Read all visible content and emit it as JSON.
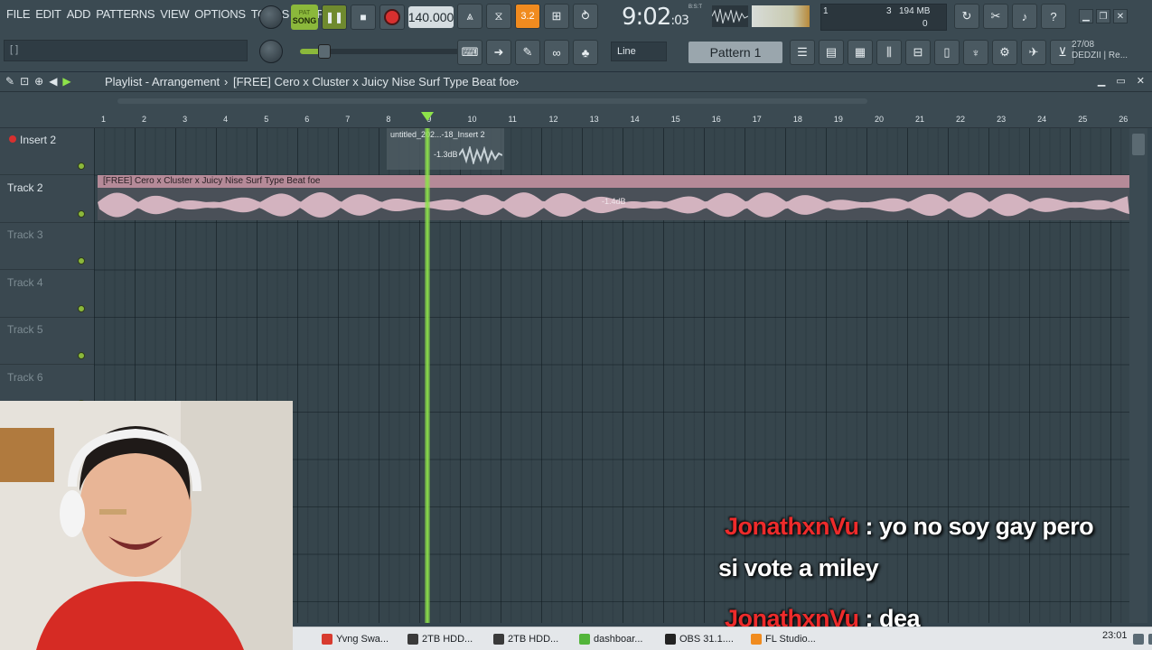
{
  "menu": [
    "FILE",
    "EDIT",
    "ADD",
    "PATTERNS",
    "VIEW",
    "OPTIONS",
    "TOOLS",
    "HELP"
  ],
  "hint_text": "[ ]",
  "transport": {
    "pat_label": "PAT",
    "song_label": "SONG",
    "play": "❚❚",
    "stop": "■",
    "tempo": "140.000"
  },
  "snap_label": "3.2",
  "clock": {
    "time": "9:02",
    "sub": "03",
    "bst": "B:S:T"
  },
  "cpu": {
    "voices": "3",
    "mem": "194 MB",
    "poly": "0",
    "cpu": "1"
  },
  "window_buttons": [
    "▁",
    "❐",
    "✕"
  ],
  "line_mode": "Line",
  "pattern": "Pattern 1",
  "date_box": {
    "date": "27/08",
    "user": "DEDZII | Re..."
  },
  "playlist": {
    "title": "Playlist - Arrangement",
    "separator": "›",
    "song_name": "[FREE] Cero x Cluster x Juicy Nise  Surf Type Beat  foe",
    "song_arrow": "›"
  },
  "ruler": [
    "1",
    "2",
    "3",
    "4",
    "5",
    "6",
    "7",
    "8",
    "9",
    "10",
    "11",
    "12",
    "13",
    "14",
    "15",
    "16",
    "17",
    "18",
    "19",
    "20",
    "21",
    "22",
    "23",
    "24",
    "25",
    "26"
  ],
  "tracks": [
    {
      "name": "Insert 2",
      "dim": false
    },
    {
      "name": "Track 2",
      "dim": false
    },
    {
      "name": "Track 3",
      "dim": true
    },
    {
      "name": "Track 4",
      "dim": true
    },
    {
      "name": "Track 5",
      "dim": true
    },
    {
      "name": "Track 6",
      "dim": true
    }
  ],
  "clips": {
    "small": {
      "label": "untitled_202...-18_Insert 2",
      "gain": "-1.3dB"
    },
    "main": {
      "label": "[FREE] Cero x Cluster x Juicy Nise  Surf Type Beat  foe",
      "gain": "-1.4dB"
    }
  },
  "chat": [
    {
      "user": "JonathxnVu",
      "text": " : yo no soy gay pero"
    },
    {
      "user": "",
      "text": "si vote a miley"
    },
    {
      "user": "JonathxnVu",
      "text": " : dea"
    }
  ],
  "taskbar": {
    "items": [
      {
        "label": "Yvng Swa...",
        "color": "#d83b2f"
      },
      {
        "label": "2TB HDD...",
        "color": "#3a3a3a"
      },
      {
        "label": "2TB HDD...",
        "color": "#3a3a3a"
      },
      {
        "label": "dashboar...",
        "color": "#53b53a"
      },
      {
        "label": "OBS 31.1....",
        "color": "#222222"
      },
      {
        "label": "FL Studio...",
        "color": "#f08b1f"
      }
    ],
    "time": "23:01"
  },
  "colors": {
    "accent_green": "#8ee34a",
    "clip_pink": "#b58a98",
    "record_red": "#d8302f",
    "chat_user": "#ee2b2b"
  }
}
